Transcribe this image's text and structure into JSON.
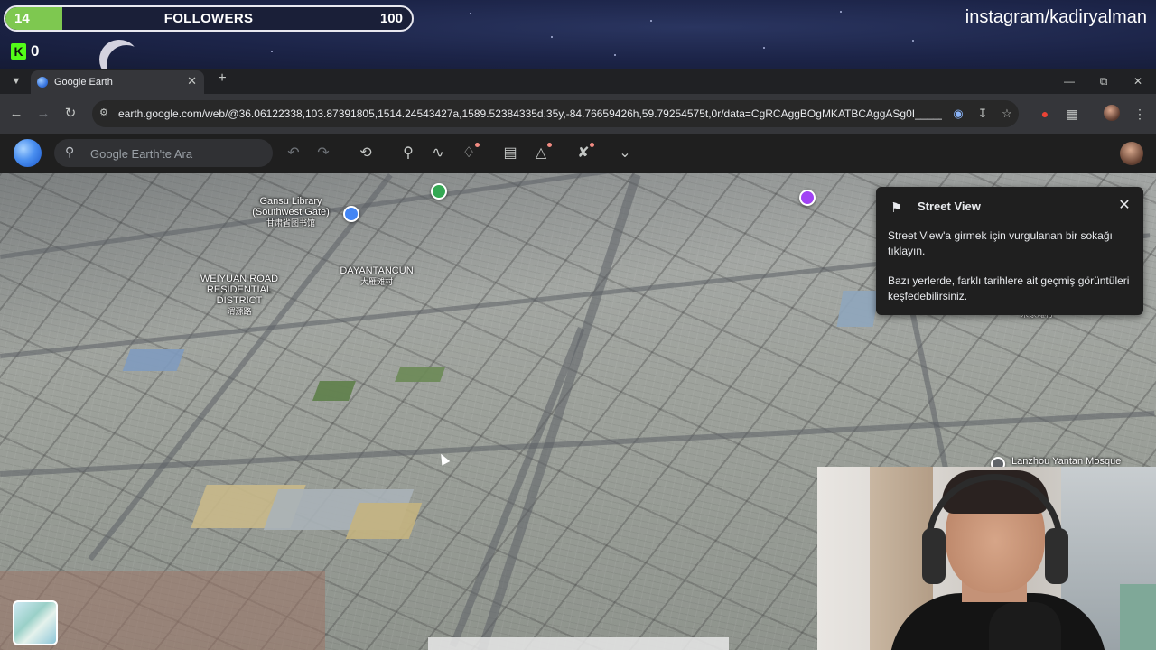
{
  "stream": {
    "followers_current": "14",
    "followers_label": "FOLLOWERS",
    "followers_goal": "100",
    "followers_progress_fraction": 0.14,
    "kick_logo": "K",
    "kick_count": "0",
    "instagram_handle": "instagram/kadiryalman"
  },
  "browser": {
    "tab_title": "Google Earth",
    "url": "earth.google.com/web/@36.06122338,103.87391805,1514.24543427a,1589.52384335d,35y,-84.76659426h,59.79254575t,0r/data=CgRCAggBOgMKATBCAggASg0I_________A..."
  },
  "earth": {
    "search_placeholder": "Google Earth'te Ara"
  },
  "map_labels": {
    "gansu_library": "Gansu Library",
    "gansu_library_2": "(Southwest Gate)",
    "gansu_library_cn": "甘肃省图书馆",
    "dayantan": "DAYANTANCUN",
    "dayantan_cn": "大雁滩村",
    "weiyuan_1": "WEIYUAN ROAD",
    "weiyuan_2": "RESIDENTIAL",
    "weiyuan_3": "DISTRICT",
    "weiyuan_cn": "渭源路",
    "mosque": "Lanzhou Yantan Mosque",
    "cn_right": "宋家滩村"
  },
  "street_view_card": {
    "title": "Street View",
    "text_1": "Street View'a girmek için vurgulanan bir sokağı tıklayın.",
    "text_2": "Bazı yerlerde, farklı tarihlere ait geçmiş görüntüleri keşfedebilirsiniz."
  },
  "colors": {
    "followers_fill": "#7ec850",
    "kick_green": "#53fc18",
    "poi_green": "#34a853",
    "poi_purple": "#a142f4",
    "poi_blue": "#4285f4"
  }
}
